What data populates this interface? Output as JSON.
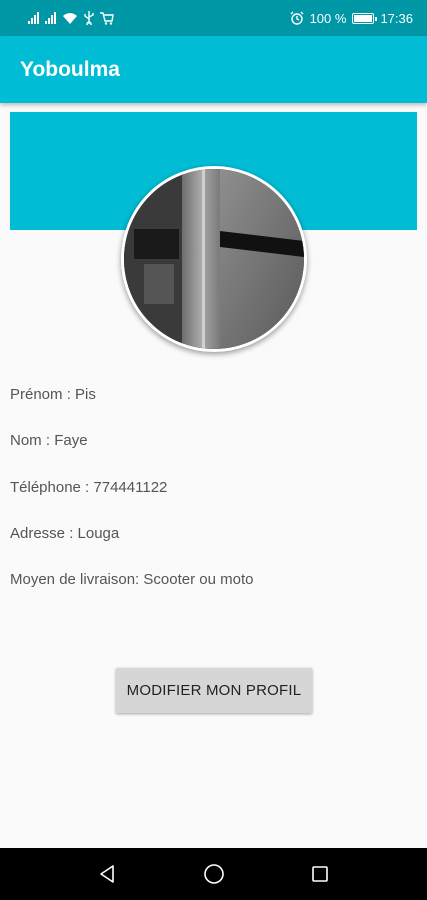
{
  "status_bar": {
    "battery_text": "100 %",
    "time": "17:36",
    "icons": [
      "signal-icon",
      "signal-icon",
      "wifi-icon",
      "usb-icon",
      "cart-icon",
      "alarm-icon",
      "battery-icon"
    ]
  },
  "app_bar": {
    "title": "Yoboulma"
  },
  "profile": {
    "fields": [
      {
        "label": "Prénom : ",
        "value": "Pis"
      },
      {
        "label": "Nom : ",
        "value": "Faye"
      },
      {
        "label": "Téléphone : ",
        "value": "774441122"
      },
      {
        "label": "Adresse : ",
        "value": "Louga"
      },
      {
        "label": "Moyen de livraison: ",
        "value": "Scooter ou moto"
      }
    ]
  },
  "actions": {
    "modify_label": "MODIFIER MON PROFIL"
  },
  "nav": {
    "icons": [
      "back-icon",
      "home-icon",
      "recents-icon"
    ]
  },
  "colors": {
    "primary": "#00bcd4",
    "primary_dark": "#0097a7",
    "background": "#fafafa",
    "button": "#d6d6d6"
  }
}
